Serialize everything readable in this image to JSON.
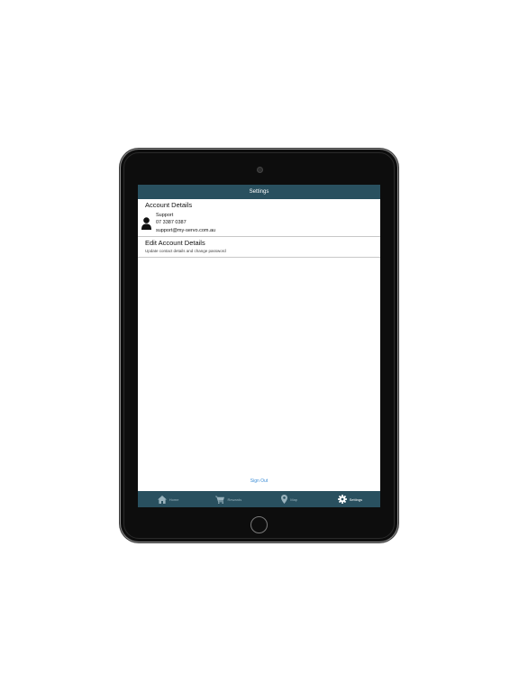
{
  "navbar": {
    "title": "Settings"
  },
  "account_section": {
    "header": "Account Details",
    "name": "Support",
    "phone": "07 3387 0387",
    "email": "support@my-servo.com.au",
    "icon": "person-icon"
  },
  "edit_account": {
    "title": "Edit Account Details",
    "subtitle": "Update contact details and change password"
  },
  "sign_out_label": "Sign Out",
  "tabs": [
    {
      "label": "Home",
      "icon": "home-icon"
    },
    {
      "label": "Rewards",
      "icon": "cart-icon"
    },
    {
      "label": "Map",
      "icon": "map-pin-icon"
    },
    {
      "label": "Settings",
      "icon": "gear-icon"
    }
  ],
  "active_tab": "Settings",
  "colors": {
    "bar": "#29505f",
    "link": "#3d8ed6",
    "inactive_tab": "#9ab3bd"
  }
}
